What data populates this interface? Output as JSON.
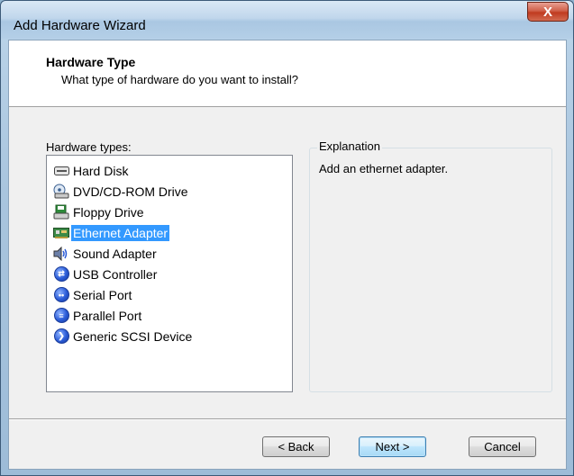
{
  "window": {
    "title": "Add Hardware Wizard",
    "close_label": "X"
  },
  "header": {
    "title": "Hardware Type",
    "subtitle": "What type of hardware do you want to install?"
  },
  "hardware_types": {
    "label": "Hardware types:",
    "items": [
      {
        "label": "Hard Disk",
        "icon": "hard-disk-icon",
        "selected": false
      },
      {
        "label": "DVD/CD-ROM Drive",
        "icon": "dvd-drive-icon",
        "selected": false
      },
      {
        "label": "Floppy Drive",
        "icon": "floppy-drive-icon",
        "selected": false
      },
      {
        "label": "Ethernet Adapter",
        "icon": "ethernet-adapter-icon",
        "selected": true
      },
      {
        "label": "Sound Adapter",
        "icon": "speaker-icon",
        "selected": false
      },
      {
        "label": "USB Controller",
        "icon": "usb-icon",
        "selected": false
      },
      {
        "label": "Serial Port",
        "icon": "serial-port-icon",
        "selected": false
      },
      {
        "label": "Parallel Port",
        "icon": "parallel-port-icon",
        "selected": false
      },
      {
        "label": "Generic SCSI Device",
        "icon": "scsi-device-icon",
        "selected": false
      }
    ]
  },
  "explanation": {
    "label": "Explanation",
    "text": "Add an ethernet adapter."
  },
  "buttons": {
    "back": "< Back",
    "next": "Next >",
    "cancel": "Cancel"
  },
  "colors": {
    "selection": "#3399ff",
    "dialog_bg": "#f0f0f0",
    "close_button": "#c03a1f"
  }
}
